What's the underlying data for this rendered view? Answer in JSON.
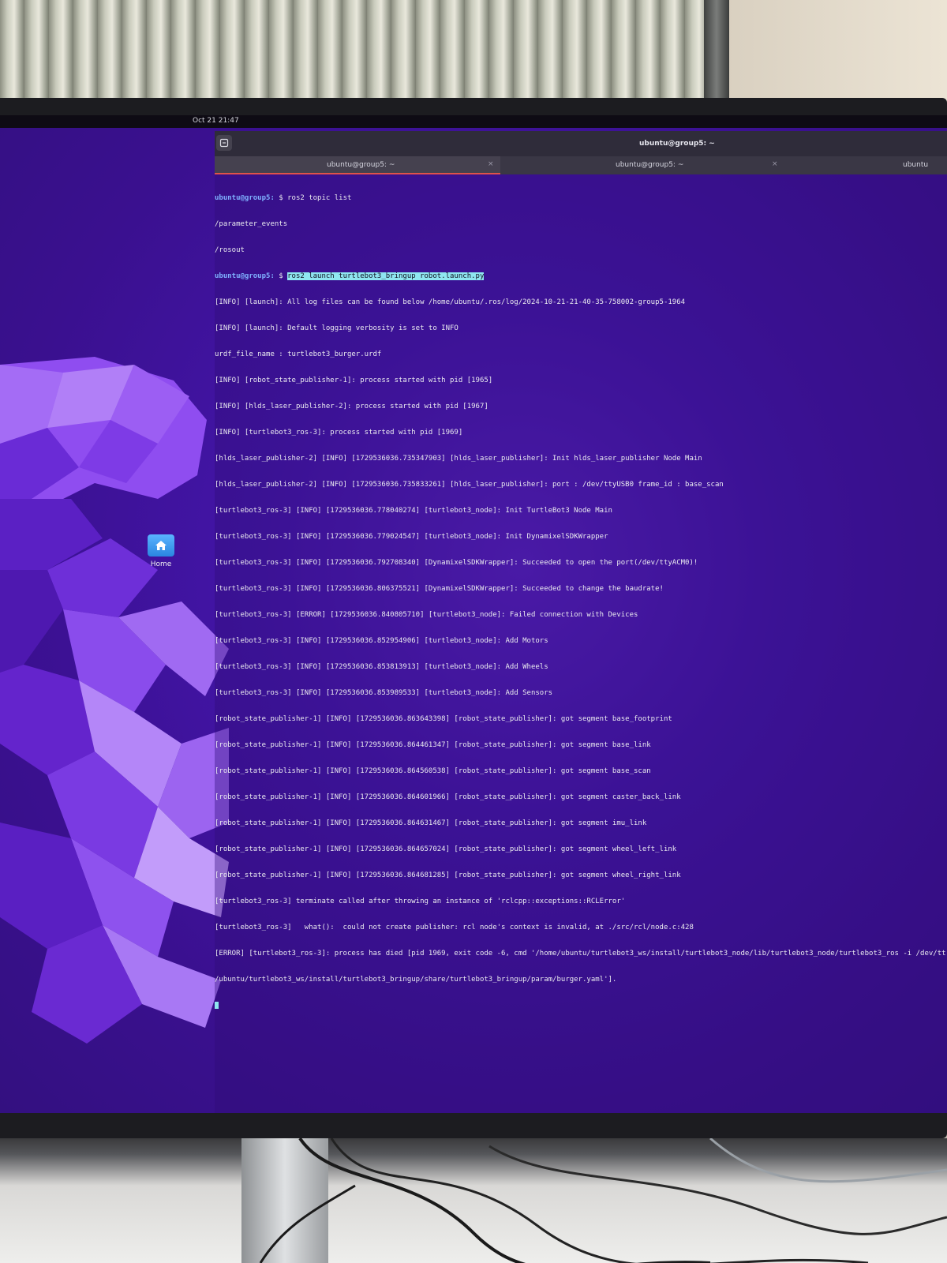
{
  "topbar": {
    "clock": "Oct 21 21:47"
  },
  "desktop": {
    "home_label": "Home"
  },
  "terminal": {
    "window_title": "ubuntu@group5: ~",
    "tabs": [
      {
        "label": "ubuntu@group5: ~",
        "close": "×"
      },
      {
        "label": "ubuntu@group5: ~",
        "close": "×"
      },
      {
        "label": "ubuntu"
      }
    ],
    "prompt": "ubuntu@group5:",
    "prompt_tail": " $ ",
    "cmd1": "ros2 topic list",
    "out1": [
      "/parameter_events",
      "/rosout"
    ],
    "cmd2": "ros2 launch turtlebot3_bringup robot.launch.py",
    "log": [
      "[INFO] [launch]: All log files can be found below /home/ubuntu/.ros/log/2024-10-21-21-40-35-758002-group5-1964",
      "[INFO] [launch]: Default logging verbosity is set to INFO",
      "urdf_file_name : turtlebot3_burger.urdf",
      "[INFO] [robot_state_publisher-1]: process started with pid [1965]",
      "[INFO] [hlds_laser_publisher-2]: process started with pid [1967]",
      "[INFO] [turtlebot3_ros-3]: process started with pid [1969]",
      "[hlds_laser_publisher-2] [INFO] [1729536036.735347903] [hlds_laser_publisher]: Init hlds_laser_publisher Node Main",
      "[hlds_laser_publisher-2] [INFO] [1729536036.735833261] [hlds_laser_publisher]: port : /dev/ttyUSB0 frame_id : base_scan",
      "[turtlebot3_ros-3] [INFO] [1729536036.778040274] [turtlebot3_node]: Init TurtleBot3 Node Main",
      "[turtlebot3_ros-3] [INFO] [1729536036.779024547] [turtlebot3_node]: Init DynamixelSDKWrapper",
      "[turtlebot3_ros-3] [INFO] [1729536036.792708340] [DynamixelSDKWrapper]: Succeeded to open the port(/dev/ttyACM0)!",
      "[turtlebot3_ros-3] [INFO] [1729536036.806375521] [DynamixelSDKWrapper]: Succeeded to change the baudrate!",
      "[turtlebot3_ros-3] [ERROR] [1729536036.840805710] [turtlebot3_node]: Failed connection with Devices",
      "[turtlebot3_ros-3] [INFO] [1729536036.852954906] [turtlebot3_node]: Add Motors",
      "[turtlebot3_ros-3] [INFO] [1729536036.853813913] [turtlebot3_node]: Add Wheels",
      "[turtlebot3_ros-3] [INFO] [1729536036.853989533] [turtlebot3_node]: Add Sensors",
      "[robot_state_publisher-1] [INFO] [1729536036.863643398] [robot_state_publisher]: got segment base_footprint",
      "[robot_state_publisher-1] [INFO] [1729536036.864461347] [robot_state_publisher]: got segment base_link",
      "[robot_state_publisher-1] [INFO] [1729536036.864560538] [robot_state_publisher]: got segment base_scan",
      "[robot_state_publisher-1] [INFO] [1729536036.864601966] [robot_state_publisher]: got segment caster_back_link",
      "[robot_state_publisher-1] [INFO] [1729536036.864631467] [robot_state_publisher]: got segment imu_link",
      "[robot_state_publisher-1] [INFO] [1729536036.864657024] [robot_state_publisher]: got segment wheel_left_link",
      "[robot_state_publisher-1] [INFO] [1729536036.864681285] [robot_state_publisher]: got segment wheel_right_link",
      "[turtlebot3_ros-3] terminate called after throwing an instance of 'rclcpp::exceptions::RCLError'",
      "[turtlebot3_ros-3]   what():  could not create publisher: rcl node's context is invalid, at ./src/rcl/node.c:428",
      "[ERROR] [turtlebot3_ros-3]: process has died [pid 1969, exit code -6, cmd '/home/ubuntu/turtlebot3_ws/install/turtlebot3_node/lib/turtlebot3_node/turtlebot3_ros -i /dev/tt",
      "/ubuntu/turtlebot3_ws/install/turtlebot3_bringup/share/turtlebot3_bringup/param/burger.yaml']."
    ]
  },
  "colors": {
    "wallpaper": "#4315a8",
    "prompt": "#7fb1ff",
    "selection": "#8fe6f0",
    "tab_indicator": "#e0524a"
  }
}
